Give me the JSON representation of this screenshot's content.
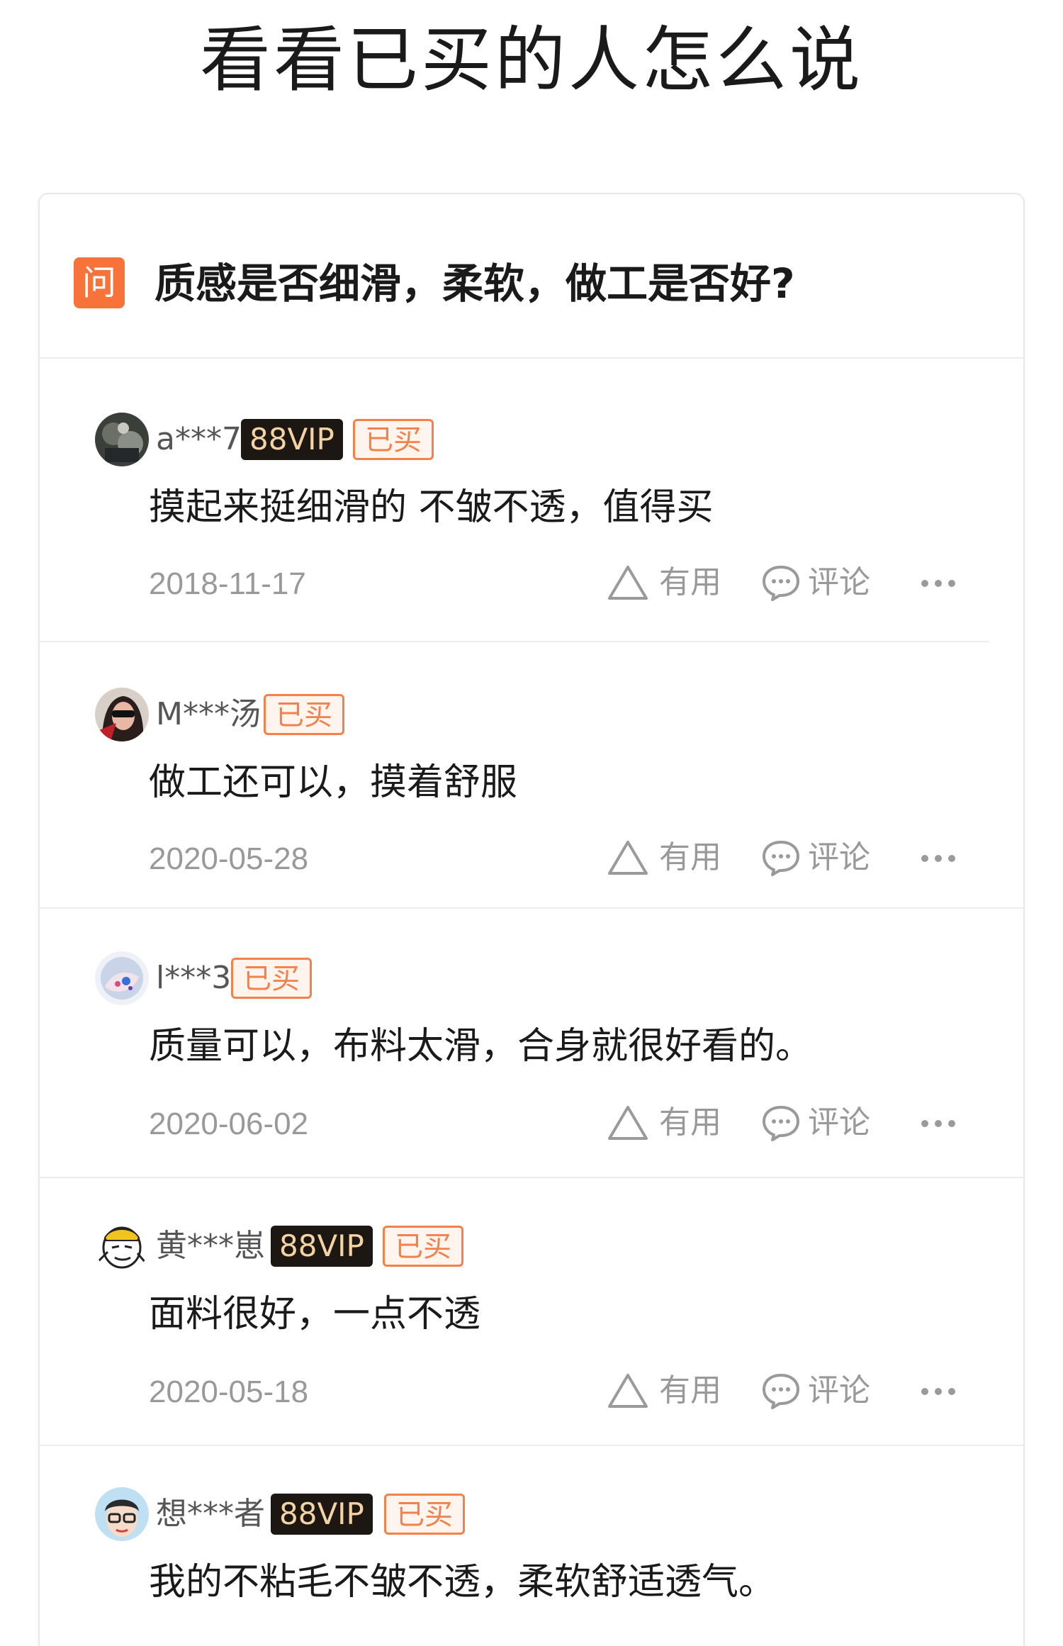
{
  "page": {
    "title": "看看已买的人怎么说"
  },
  "question": {
    "badge": "问",
    "text": "质感是否细滑，柔软，做工是否好?"
  },
  "actions": {
    "useful": "有用",
    "comment": "评论"
  },
  "reviews": [
    {
      "username": "a***7",
      "vip": "88VIP",
      "bought": "已买",
      "content": "摸起来挺细滑的  不皱不透，值得买",
      "date": "2018-11-17"
    },
    {
      "username": "M***汤",
      "vip": "",
      "bought": "已买",
      "content": "做工还可以，摸着舒服",
      "date": "2020-05-28"
    },
    {
      "username": "l***3",
      "vip": "",
      "bought": "已买",
      "content": "质量可以，布料太滑，合身就很好看的。",
      "date": "2020-06-02"
    },
    {
      "username": "黄***崽",
      "vip": "88VIP",
      "bought": "已买",
      "content": "面料很好，一点不透",
      "date": "2020-05-18"
    },
    {
      "username": "想***者",
      "vip": "88VIP",
      "bought": "已买",
      "content": "我的不粘毛不皱不透，柔软舒适透气。",
      "date": ""
    }
  ]
}
